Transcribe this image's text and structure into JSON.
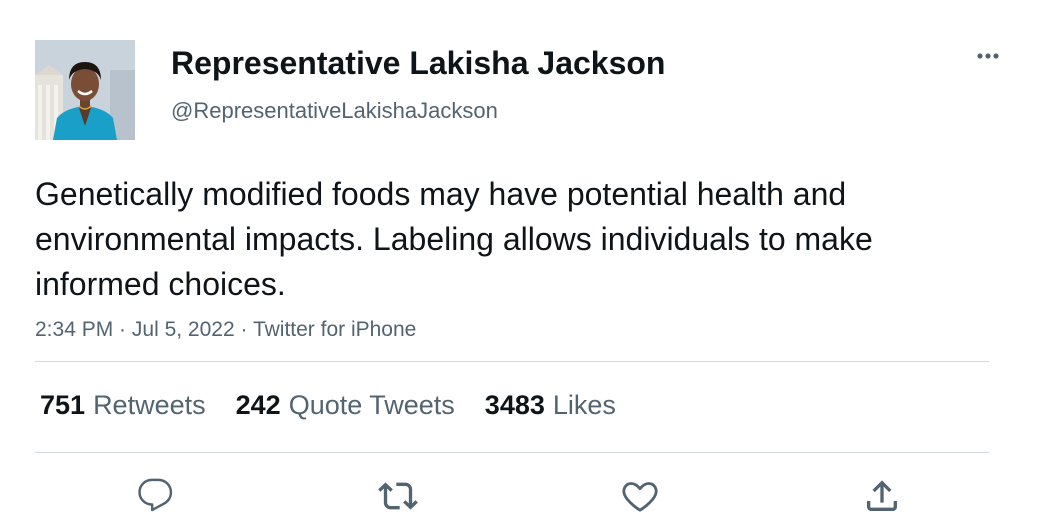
{
  "tweet": {
    "author": {
      "display_name": "Representative Lakisha Jackson",
      "handle": "@RepresentativeLakishaJackson"
    },
    "text": "Genetically modified foods may have potential health and environmental impacts. Labeling allows individuals to make informed choices.",
    "timestamp": {
      "time": "2:34 PM",
      "date": "Jul 5, 2022",
      "source": "Twitter for iPhone",
      "separator": " · "
    },
    "stats": {
      "retweets": {
        "count": "751",
        "label": "Retweets"
      },
      "quote_tweets": {
        "count": "242",
        "label": "Quote Tweets"
      },
      "likes": {
        "count": "3483",
        "label": "Likes"
      }
    }
  },
  "icons": {
    "more": "more-horizontal-icon",
    "reply": "reply-icon",
    "retweet": "retweet-icon",
    "like": "heart-icon",
    "share": "share-icon"
  },
  "colors": {
    "text_primary": "#0f1419",
    "text_secondary": "#536471",
    "divider": "#cfd9de",
    "icon": "#536471"
  }
}
